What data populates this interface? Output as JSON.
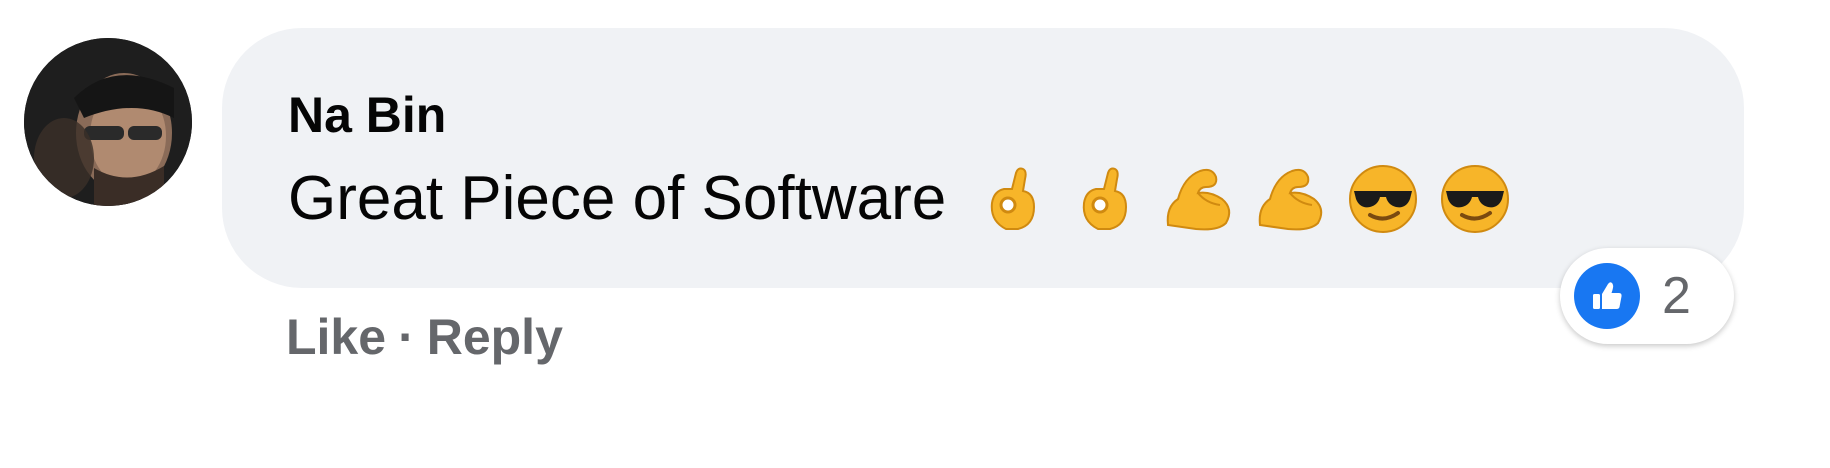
{
  "comment": {
    "author": "Na Bin",
    "text": "Great Piece of Software",
    "emojis": [
      "ok-hand-emoji",
      "ok-hand-emoji",
      "flexed-biceps-emoji",
      "flexed-biceps-emoji",
      "sunglasses-face-emoji",
      "sunglasses-face-emoji"
    ],
    "reaction": {
      "icon": "like-thumbs-up-icon",
      "count": "2",
      "color": "#1877f2"
    },
    "actions": {
      "like": "Like",
      "separator": "·",
      "reply": "Reply"
    }
  },
  "colors": {
    "bubble": "#f0f2f5",
    "text": "#050505",
    "secondary_text": "#65676b",
    "emoji": "#f7b529"
  }
}
